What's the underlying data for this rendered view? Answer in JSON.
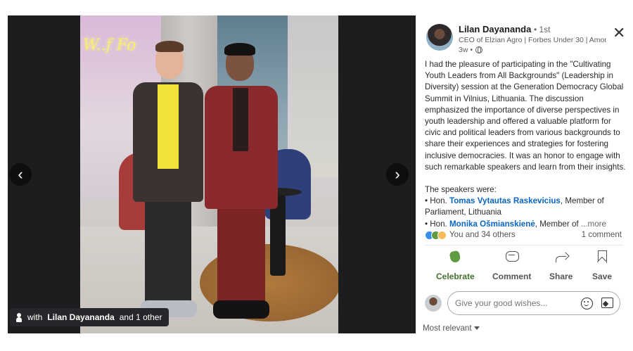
{
  "media": {
    "prev_glyph": "‹",
    "next_glyph": "›",
    "photo_neon_text": "W..f Fo",
    "tag": {
      "prefix": "with",
      "name": "Lilan Dayananda",
      "suffix": "and 1 other"
    }
  },
  "author": {
    "name": "Lilan Dayananda",
    "degree": "• 1st",
    "headline": "CEO of Elzian Agro | Forbes Under 30 | Amon...",
    "time": "3w •"
  },
  "close_glyph": "✕",
  "post": {
    "paragraph1": "I had the pleasure of participating in the \"Cultivating Youth Leaders from All Backgrounds\" (Leadership in Diversity) session at the Generation Democracy Global Summit in Vilnius, Lithuania. The discussion emphasized the importance of diverse perspectives in youth leadership and offered a valuable platform for civic and political leaders from various backgrounds to share their experiences and strategies for fostering inclusive democracies. It was an honor to engage with such remarkable speakers and learn from their insights.",
    "speakers_intro": "The speakers were:",
    "speaker1_prefix": "• Hon. ",
    "speaker1_name": "Tomas Vytautas Raskevicius",
    "speaker1_suffix": ", Member of Parliament, Lithuania",
    "speaker2_prefix": "• Hon. ",
    "speaker2_name": "Monika Ošmianskienė",
    "speaker2_suffix": ", Member of",
    "more_label": "...more"
  },
  "reactions": {
    "count_label": "You and 34 others",
    "comments_label": "1 comment"
  },
  "actions": {
    "celebrate": "Celebrate",
    "comment": "Comment",
    "share": "Share",
    "save": "Save"
  },
  "comment_box": {
    "placeholder": "Give your good wishes..."
  },
  "sort": {
    "label": "Most relevant"
  },
  "colors": {
    "link": "#0a66c2",
    "celebrate": "#44712e",
    "media_bg": "#1c1d1f"
  }
}
